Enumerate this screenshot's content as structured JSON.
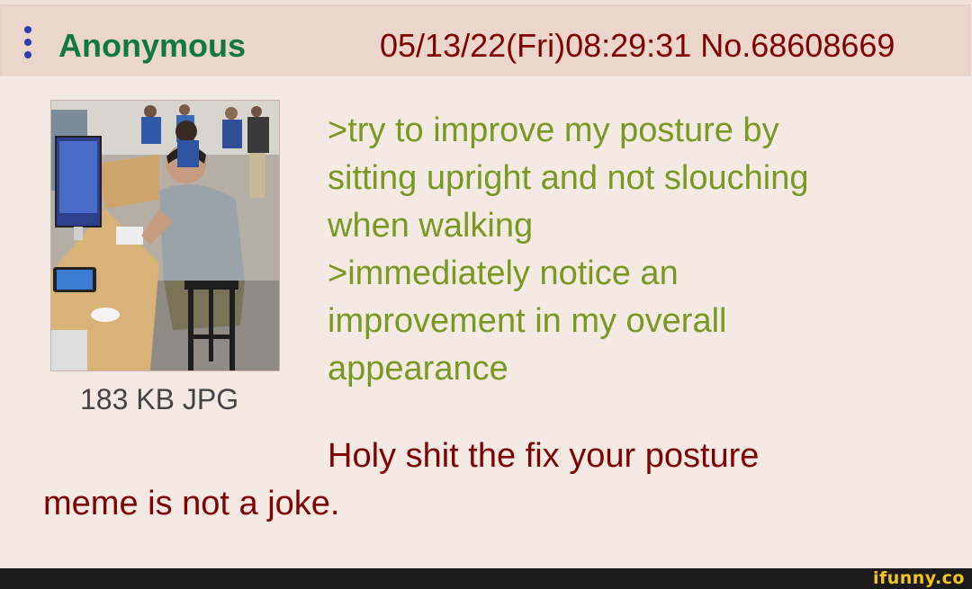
{
  "post": {
    "name": "Anonymous",
    "meta": "05/13/22(Fri)08:29:31 No.68608669",
    "file_info": "183 KB JPG",
    "greentext_lines": [
      ">try to improve my posture by",
      "sitting upright and not slouching",
      "when walking",
      ">immediately notice an",
      "improvement in my overall",
      "appearance"
    ],
    "reply_lines": [
      "Holy shit the fix your posture",
      "meme is not a joke."
    ]
  },
  "footer": {
    "watermark": "ifunny.co"
  },
  "colors": {
    "name": "#117743",
    "meta": "#800000",
    "greentext": "#789922",
    "reply": "#800000",
    "menu": "#2b3bb0",
    "body_bg": "#f5e9e3",
    "header_bg": "#ead6ca"
  },
  "icons": {
    "menu": "vertical-ellipsis-icon"
  }
}
